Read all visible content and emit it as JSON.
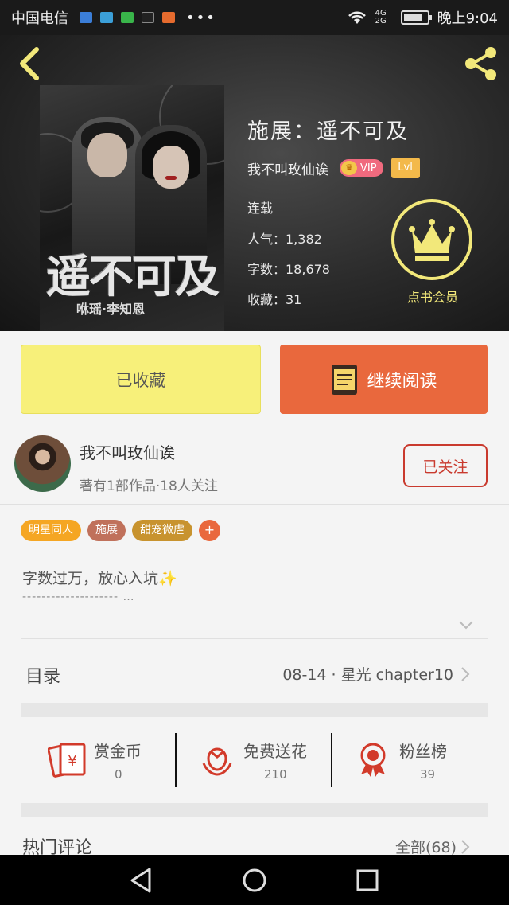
{
  "status_bar": {
    "carrier": "中国电信",
    "more": "•••",
    "network": "4G 2G",
    "time": "晚上9:04",
    "battery_level": 0.85
  },
  "header": {
    "back_icon": "chevron-left-icon",
    "share_icon": "share-icon"
  },
  "book": {
    "cover_title": "遥不可及",
    "cover_subtitle": "咻瑶·李知恩",
    "title": "施展：遥不可及",
    "author_name": "我不叫玫仙诶",
    "vip_label": "VIP",
    "level_label": "Lvl",
    "status": "连载",
    "popularity": "人气：1,382",
    "word_count": "字数：18,678",
    "favorites": "收藏：31",
    "member_button": "点书会员"
  },
  "actions": {
    "collected_label": "已收藏",
    "continue_label": "继续阅读"
  },
  "author": {
    "name": "我不叫玫仙诶",
    "stats": "著有1部作品·18人关注",
    "follow_label": "已关注"
  },
  "tags": [
    {
      "label": "明星同人",
      "color": "#f5a623"
    },
    {
      "label": "施展",
      "color": "#c0715b"
    },
    {
      "label": "甜宠微虐",
      "color": "#c8932e"
    }
  ],
  "tag_add": "+",
  "intro": {
    "text": "字数过万，放心入坑✨",
    "dashes": "-------------------- …"
  },
  "catalog": {
    "label": "目录",
    "latest": "08-14 · 星光 chapter10"
  },
  "support": [
    {
      "icon": "red-envelope-icon",
      "title": "赏金币",
      "value": "0"
    },
    {
      "icon": "flower-icon",
      "title": "免费送花",
      "value": "210"
    },
    {
      "icon": "medal-icon",
      "title": "粉丝榜",
      "value": "39"
    }
  ],
  "comments": {
    "label": "热门评论",
    "all_label": "全部(68)"
  },
  "colors": {
    "accent_orange": "#e9683d",
    "accent_yellow": "#f7f07a",
    "follow_red": "#c93a2e",
    "crown_yellow": "#f2e87a"
  }
}
